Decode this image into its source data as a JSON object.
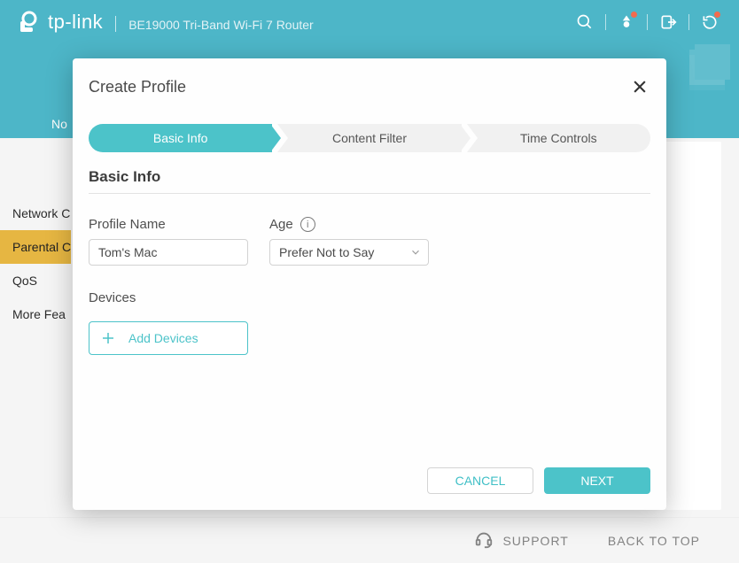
{
  "header": {
    "brand": "tp-link",
    "product": "BE19000 Tri-Band Wi-Fi 7 Router"
  },
  "subheader": {
    "tab_peek": "No"
  },
  "sidebar": {
    "items": [
      {
        "label": "Network C",
        "active": false
      },
      {
        "label": "Parental C",
        "active": true
      },
      {
        "label": "QoS",
        "active": false
      },
      {
        "label": "More Fea",
        "active": false
      }
    ]
  },
  "modal": {
    "title": "Create Profile",
    "steps": [
      {
        "label": "Basic Info",
        "active": true
      },
      {
        "label": "Content Filter",
        "active": false
      },
      {
        "label": "Time Controls",
        "active": false
      }
    ],
    "section_title": "Basic Info",
    "profile_name_label": "Profile Name",
    "profile_name_value": "Tom's Mac",
    "age_label": "Age",
    "age_value": "Prefer Not to Say",
    "devices_label": "Devices",
    "add_devices_label": "Add Devices",
    "cancel_label": "CANCEL",
    "next_label": "NEXT"
  },
  "footer": {
    "support": "SUPPORT",
    "back_to_top": "BACK TO TOP"
  }
}
